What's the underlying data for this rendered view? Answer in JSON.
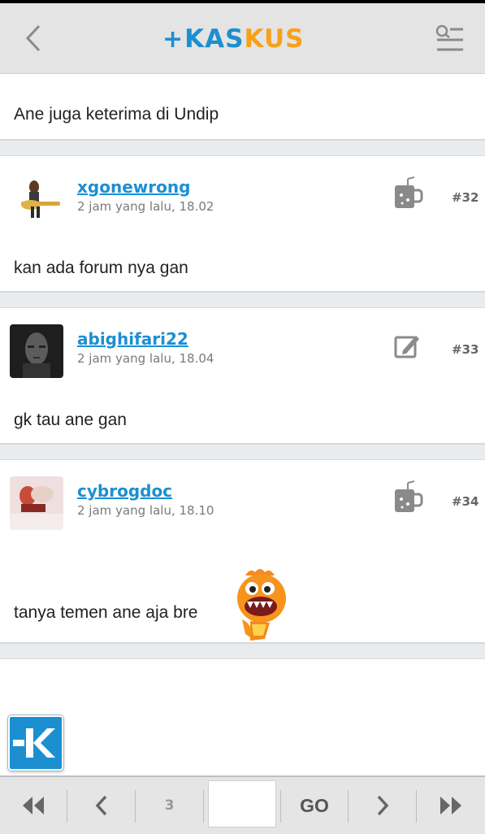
{
  "header": {
    "logo_part1": "KAS",
    "logo_part2": "KUS",
    "brand_blue": "#1c8fd1",
    "brand_orange": "#f7a11a"
  },
  "posts": [
    {
      "message": "Ane juga keterima di Undip"
    },
    {
      "username": "xgonewrong",
      "time": "2 jam yang lalu, 18.02",
      "post_number": "#32",
      "status_icon": "mug-icon",
      "message": "kan ada forum nya gan"
    },
    {
      "username": "abighifari22",
      "time": "2 jam yang lalu, 18.04",
      "post_number": "#33",
      "status_icon": "edit-icon",
      "message": "gk tau ane gan"
    },
    {
      "username": "cybrogdoc",
      "time": "2 jam yang lalu, 18.10",
      "post_number": "#34",
      "status_icon": "mug-icon",
      "message": "tanya temen ane aja bre"
    }
  ],
  "pager": {
    "current_page": "3",
    "go_label": "GO",
    "page_input_value": ""
  }
}
